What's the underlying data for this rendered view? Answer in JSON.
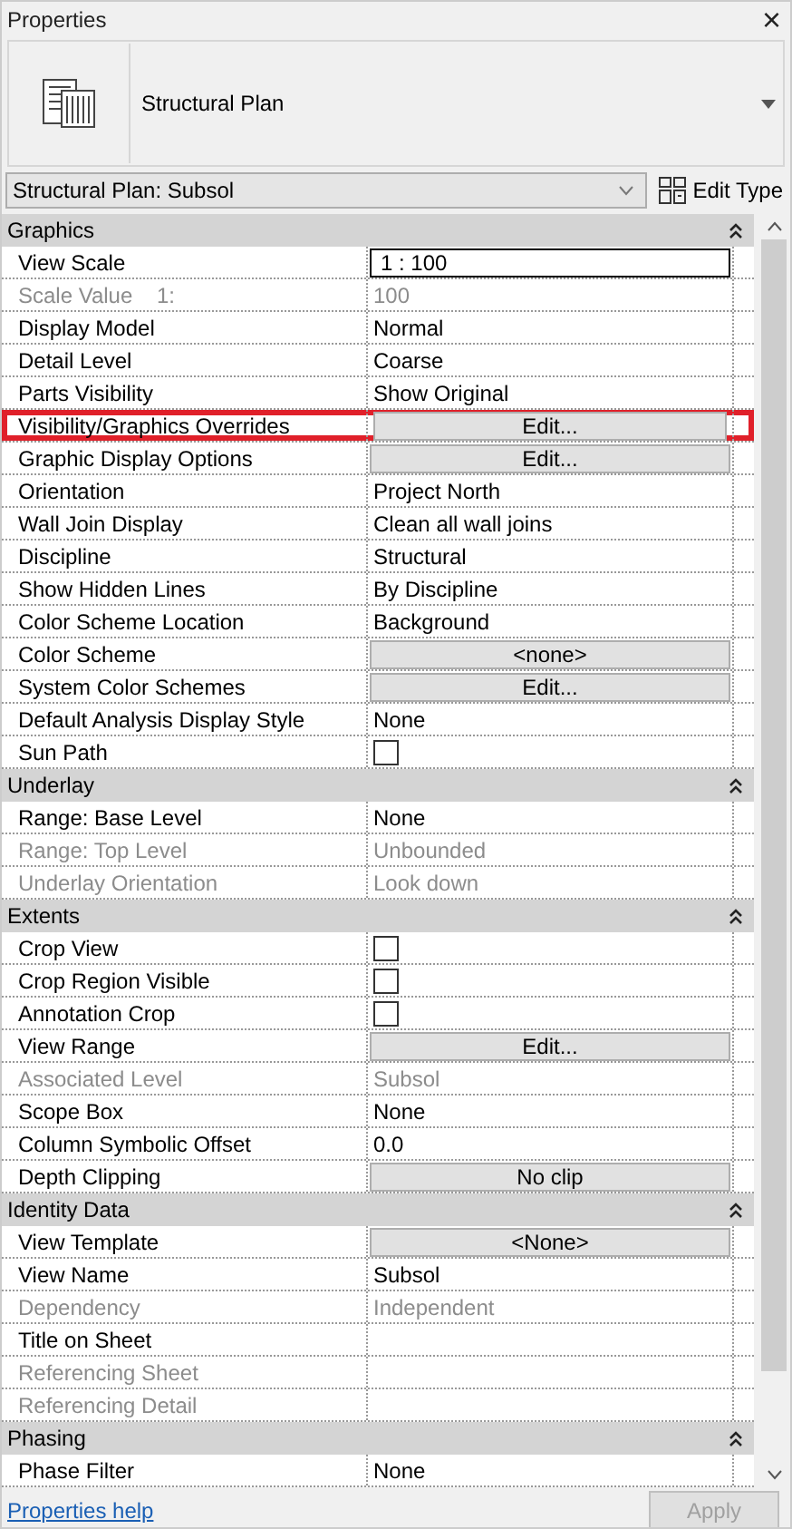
{
  "window": {
    "title": "Properties",
    "close": "×"
  },
  "type": {
    "name": "Structural Plan"
  },
  "selector": {
    "value": "Structural Plan: Subsol",
    "edit_type": "Edit Type"
  },
  "groups": [
    {
      "title": "Graphics",
      "rows": [
        {
          "name": "View Scale",
          "kind": "field",
          "value": "1 : 100",
          "disabled": false,
          "highlighted": false
        },
        {
          "name": "Scale Value    1:",
          "kind": "text",
          "value": "100",
          "disabled": true,
          "highlighted": false
        },
        {
          "name": "Display Model",
          "kind": "text",
          "value": "Normal",
          "disabled": false,
          "highlighted": false
        },
        {
          "name": "Detail Level",
          "kind": "text",
          "value": "Coarse",
          "disabled": false,
          "highlighted": false
        },
        {
          "name": "Parts Visibility",
          "kind": "text",
          "value": "Show Original",
          "disabled": false,
          "highlighted": false
        },
        {
          "name": "Visibility/Graphics Overrides",
          "kind": "button",
          "value": "Edit...",
          "disabled": false,
          "highlighted": true
        },
        {
          "name": "Graphic Display Options",
          "kind": "button",
          "value": "Edit...",
          "disabled": false,
          "highlighted": false
        },
        {
          "name": "Orientation",
          "kind": "text",
          "value": "Project North",
          "disabled": false,
          "highlighted": false
        },
        {
          "name": "Wall Join Display",
          "kind": "text",
          "value": "Clean all wall joins",
          "disabled": false,
          "highlighted": false
        },
        {
          "name": "Discipline",
          "kind": "text",
          "value": "Structural",
          "disabled": false,
          "highlighted": false
        },
        {
          "name": "Show Hidden Lines",
          "kind": "text",
          "value": "By Discipline",
          "disabled": false,
          "highlighted": false
        },
        {
          "name": "Color Scheme Location",
          "kind": "text",
          "value": "Background",
          "disabled": false,
          "highlighted": false
        },
        {
          "name": "Color Scheme",
          "kind": "button",
          "value": "<none>",
          "disabled": false,
          "highlighted": false
        },
        {
          "name": "System Color Schemes",
          "kind": "button",
          "value": "Edit...",
          "disabled": false,
          "highlighted": false
        },
        {
          "name": "Default Analysis Display Style",
          "kind": "text",
          "value": "None",
          "disabled": false,
          "highlighted": false
        },
        {
          "name": "Sun Path",
          "kind": "checkbox",
          "checked": false,
          "disabled": false,
          "highlighted": false
        }
      ]
    },
    {
      "title": "Underlay",
      "rows": [
        {
          "name": "Range: Base Level",
          "kind": "text",
          "value": "None",
          "disabled": false,
          "highlighted": false
        },
        {
          "name": "Range: Top Level",
          "kind": "text",
          "value": "Unbounded",
          "disabled": true,
          "highlighted": false
        },
        {
          "name": "Underlay Orientation",
          "kind": "text",
          "value": "Look down",
          "disabled": true,
          "highlighted": false
        }
      ]
    },
    {
      "title": "Extents",
      "rows": [
        {
          "name": "Crop View",
          "kind": "checkbox",
          "checked": false,
          "disabled": false,
          "highlighted": false
        },
        {
          "name": "Crop Region Visible",
          "kind": "checkbox",
          "checked": false,
          "disabled": false,
          "highlighted": false
        },
        {
          "name": "Annotation Crop",
          "kind": "checkbox",
          "checked": false,
          "disabled": false,
          "highlighted": false
        },
        {
          "name": "View Range",
          "kind": "button",
          "value": "Edit...",
          "disabled": false,
          "highlighted": false
        },
        {
          "name": "Associated Level",
          "kind": "text",
          "value": "Subsol",
          "disabled": true,
          "highlighted": false
        },
        {
          "name": "Scope Box",
          "kind": "text",
          "value": "None",
          "disabled": false,
          "highlighted": false
        },
        {
          "name": "Column Symbolic Offset",
          "kind": "text",
          "value": "0.0",
          "disabled": false,
          "highlighted": false
        },
        {
          "name": "Depth Clipping",
          "kind": "button",
          "value": "No clip",
          "disabled": false,
          "highlighted": false
        }
      ]
    },
    {
      "title": "Identity Data",
      "rows": [
        {
          "name": "View Template",
          "kind": "button",
          "value": "<None>",
          "disabled": false,
          "highlighted": false
        },
        {
          "name": "View Name",
          "kind": "text",
          "value": "Subsol",
          "disabled": false,
          "highlighted": false
        },
        {
          "name": "Dependency",
          "kind": "text",
          "value": "Independent",
          "disabled": true,
          "highlighted": false
        },
        {
          "name": "Title on Sheet",
          "kind": "text",
          "disabled": false,
          "highlighted": false
        },
        {
          "name": "Referencing Sheet",
          "kind": "text",
          "disabled": true,
          "highlighted": false
        },
        {
          "name": "Referencing Detail",
          "kind": "text",
          "disabled": true,
          "highlighted": false
        }
      ]
    },
    {
      "title": "Phasing",
      "rows": [
        {
          "name": "Phase Filter",
          "kind": "text",
          "value": "None",
          "disabled": false,
          "highlighted": false
        }
      ]
    }
  ],
  "footer": {
    "help_link": "Properties help",
    "apply": {
      "label": "Apply",
      "disabled": true
    }
  }
}
